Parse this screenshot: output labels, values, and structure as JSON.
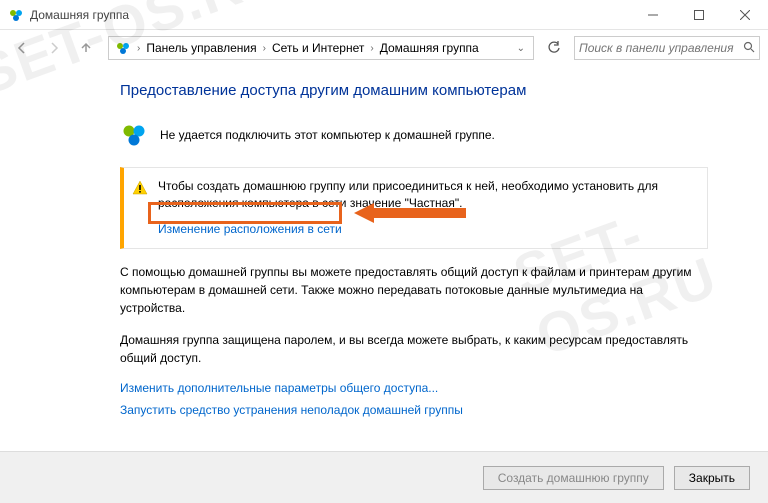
{
  "window": {
    "title": "Домашняя группа"
  },
  "breadcrumb": {
    "items": [
      "Панель управления",
      "Сеть и Интернет",
      "Домашняя группа"
    ]
  },
  "search": {
    "placeholder": "Поиск в панели управления"
  },
  "heading": "Предоставление доступа другим домашним компьютерам",
  "status": "Не удается подключить этот компьютер к домашней группе.",
  "alert": {
    "text": "Чтобы создать домашнюю группу или присоединиться к ней, необходимо установить для расположения компьютера в сети значение \"Частная\".",
    "link": "Изменение расположения в сети"
  },
  "para1": "С помощью домашней группы вы можете предоставлять общий доступ к файлам и принтерам другим компьютерам в домашней сети. Также можно передавать потоковые данные мультимедиа на устройства.",
  "para2": "Домашняя группа защищена паролем, и вы всегда можете выбрать, к каким ресурсам предоставлять общий доступ.",
  "links": {
    "advanced": "Изменить дополнительные параметры общего доступа...",
    "troubleshoot": "Запустить средство устранения неполадок домашней группы"
  },
  "footer": {
    "create": "Создать домашнюю группу",
    "close": "Закрыть"
  },
  "watermark": "SET-OS.RU"
}
